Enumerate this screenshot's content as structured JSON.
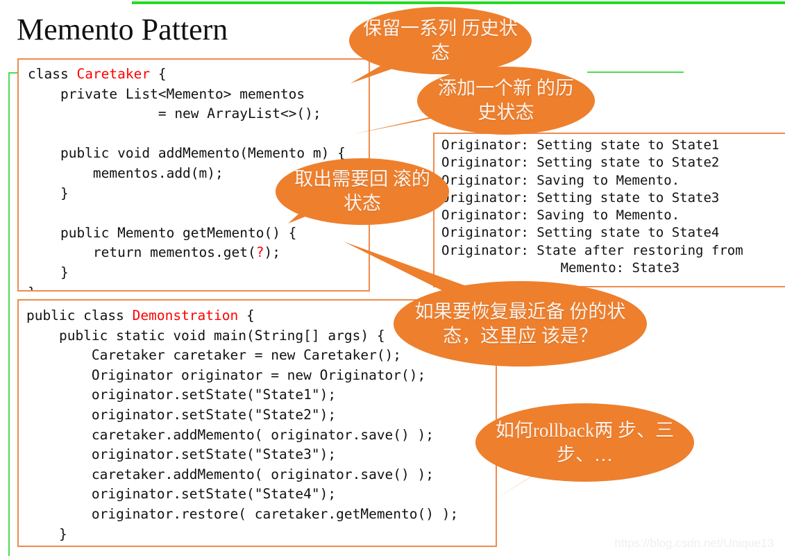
{
  "slide": {
    "title": "Memento Pattern",
    "watermark": "https://blog.csdn.net/Unique13",
    "accent_orange": "#ee7f2d",
    "border_orange": "#ed8b4e",
    "accent_green": "#4ddd4d",
    "keyword_red": "#ff0000",
    "background": "#ffffff"
  },
  "code_caretaker": {
    "name": "Caretaker class listing",
    "lines": [
      "class ",
      "Caretaker",
      " {\n    private List<Memento> mementos\n                = new ArrayList<>();\n\n    public void addMemento(Memento m) {\n        mementos.add(m);\n    }\n\n    public Memento getMemento() {\n        return mementos.get(",
      "?",
      ");\n    }\n}"
    ],
    "full_text": "class Caretaker {\n    private List<Memento> mementos\n                = new ArrayList<>();\n\n    public void addMemento(Memento m) {\n        mementos.add(m);\n    }\n\n    public Memento getMemento() {\n        return mementos.get(?);\n    }\n}",
    "prefix": "class ",
    "class_name": "Caretaker",
    "body_before_q": " {\n    private List<Memento> mementos\n                = new ArrayList<>();\n\n    public void addMemento(Memento m) {\n        mementos.add(m);\n    }\n\n    public Memento getMemento() {\n        return mementos.get(",
    "question_mark": "?",
    "body_after_q": ");\n    }\n}"
  },
  "code_demo": {
    "name": "Demonstration class listing",
    "prefix": "public class ",
    "class_name": "Demonstration",
    "body": " {\n    public static void main(String[] args) {\n        Caretaker caretaker = new Caretaker();\n        Originator originator = new Originator();\n        originator.setState(\"State1\");\n        originator.setState(\"State2\");\n        caretaker.addMemento( originator.save() );\n        originator.setState(\"State3\");\n        caretaker.addMemento( originator.save() );\n        originator.setState(\"State4\");\n        originator.restore( caretaker.getMemento() );\n    }\n}"
  },
  "console": {
    "name": "program output",
    "lines": [
      "Originator: Setting state to State1",
      "Originator: Setting state to State2",
      "Originator: Saving to Memento.",
      "Originator: Setting state to State3",
      "Originator: Saving to Memento.",
      "Originator: Setting state to State4",
      "Originator: State after restoring from",
      "               Memento: State3"
    ],
    "text": "Originator: Setting state to State1\nOriginator: Setting state to State2\nOriginator: Saving to Memento.\nOriginator: Setting state to State3\nOriginator: Saving to Memento.\nOriginator: Setting state to State4\nOriginator: State after restoring from\n               Memento: State3"
  },
  "bubbles": [
    {
      "id": "keep-history",
      "text": "保留一系列\n历史状态"
    },
    {
      "id": "add-new-state",
      "text": "添加一个新\n的历史状态"
    },
    {
      "id": "fetch-rollback",
      "text": "取出需要回\n滚的状态"
    },
    {
      "id": "which-index",
      "text": "如果要恢复最近备\n份的状态，这里应\n该是？"
    },
    {
      "id": "rollback-steps",
      "text": "如何rollback两\n步、三步、…"
    }
  ]
}
